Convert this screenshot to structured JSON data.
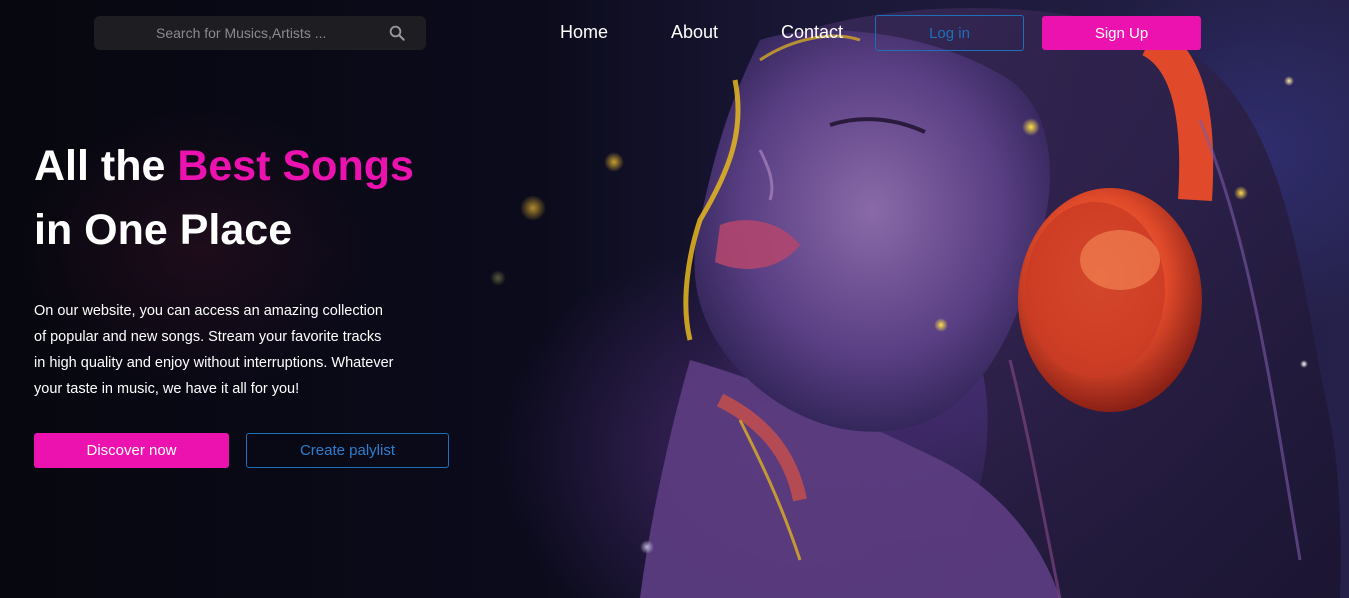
{
  "search": {
    "placeholder": "Search for Musics,Artists ...",
    "icon": "search-icon"
  },
  "nav": {
    "links": [
      "Home",
      "About",
      "Contact"
    ],
    "login_label": "Log in",
    "signup_label": "Sign Up"
  },
  "hero": {
    "headline_plain": "All the ",
    "headline_accent": "Best Songs",
    "headline_line2": "in One Place",
    "description": [
      "On our website, you can access an amazing collection",
      "of popular and new songs. Stream your favorite tracks",
      "in high quality and enjoy without interruptions. Whatever",
      "your taste in music, we have it all for you!"
    ],
    "discover_label": "Discover now",
    "playlist_label": "Create palylist"
  },
  "colors": {
    "accent": "#eb12b0",
    "outline": "#1f6fb8",
    "search_bg": "#1d1d22"
  }
}
